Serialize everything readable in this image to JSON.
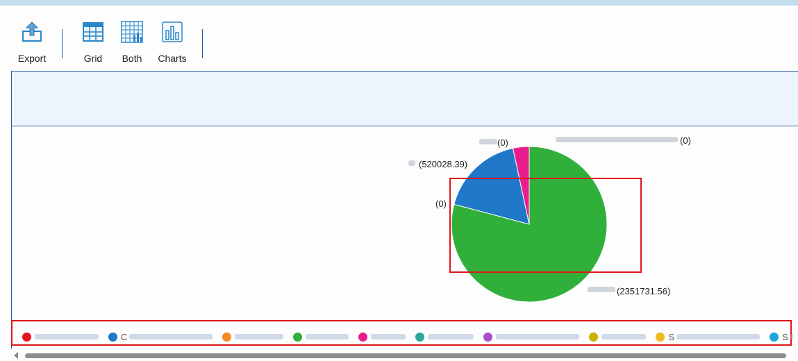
{
  "toolbar": {
    "export_label": "Export",
    "grid_label": "Grid",
    "both_label": "Both",
    "charts_label": "Charts"
  },
  "colors": {
    "accent": "#1f5c99",
    "icon_blue": "#2a86c9",
    "highlight": "#e0141c"
  },
  "icons": {
    "export": "export-icon",
    "grid": "grid-icon",
    "both": "grid-chart-icon",
    "charts": "bar-chart-icon"
  },
  "chart_data": {
    "type": "pie",
    "slices": [
      {
        "label": "(2351731.56)",
        "value": 2351731.56,
        "color": "#30b03a"
      },
      {
        "label": "(0)",
        "value": 0,
        "color": "#1f78c8"
      },
      {
        "label": "(520028.39)",
        "value": 520028.39,
        "color": "#1f78c8"
      },
      {
        "label": "(0)",
        "value": 0,
        "color": "#e91e8c"
      },
      {
        "label": "(0)",
        "value": 0,
        "color": "#e91e8c"
      }
    ],
    "pink_value": 100000
  },
  "legend": {
    "items": [
      {
        "color": "#e8141c",
        "text": ""
      },
      {
        "color": "#1f78c8",
        "text": "C"
      },
      {
        "color": "#f28c1e",
        "text": ""
      },
      {
        "color": "#30b03a",
        "text": ""
      },
      {
        "color": "#e91e8c",
        "text": ""
      },
      {
        "color": "#2aa79b",
        "text": ""
      },
      {
        "color": "#a84fd0",
        "text": ""
      },
      {
        "color": "#c8b400",
        "text": ""
      },
      {
        "color": "#f0b81c",
        "text": "S"
      },
      {
        "color": "#1aa8d8",
        "text": "S"
      }
    ]
  }
}
